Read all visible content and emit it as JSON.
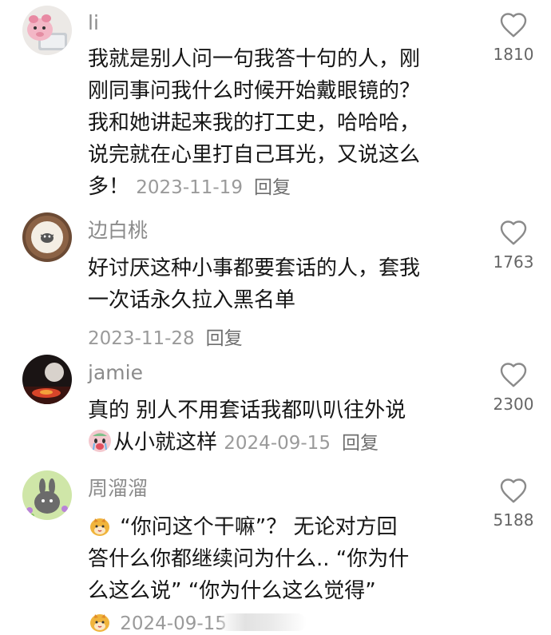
{
  "comments": [
    {
      "username": "li",
      "lines": [
        "我就是别人问一句我答十句的人，刚",
        "刚同事问我什么时候开始戴眼镜的？",
        "我和她讲起来我的打工史，哈哈哈，",
        "说完就在心里打自己耳光，又说这么"
      ],
      "last_line": "多！",
      "date": "2023-11-19",
      "reply_label": "回复",
      "likes": "1810"
    },
    {
      "username": "边白桃",
      "lines": [
        "好讨厌这种小事都要套话的人，套我",
        "一次话永久拉入黑名单"
      ],
      "date": "2023-11-28",
      "reply_label": "回复",
      "likes": "1763"
    },
    {
      "username": "jamie",
      "lines": [
        "真的 别人不用套话我都叭叭往外说"
      ],
      "last_line": "从小就这样",
      "date": "2024-09-15",
      "reply_label": "回复",
      "likes": "2300"
    },
    {
      "username": "周溜溜",
      "first_line": "“你问这个干嘛”？ 无论对方回",
      "lines": [
        "答什么你都继续问为什么.. “你为什",
        "么这么说”  “你为什么这么觉得”"
      ],
      "date": "2024-09-15",
      "reply_label": "回复",
      "likes": "5188"
    }
  ],
  "icons": {
    "like": "heart-outline-icon",
    "sticker_crying": "crying-face-sticker-icon",
    "sticker_bear": "cute-bear-sticker-icon"
  },
  "colors": {
    "text": "#161616",
    "username": "#8b8b8b",
    "meta": "#9a9a9a",
    "reply": "#6e6e6e"
  }
}
